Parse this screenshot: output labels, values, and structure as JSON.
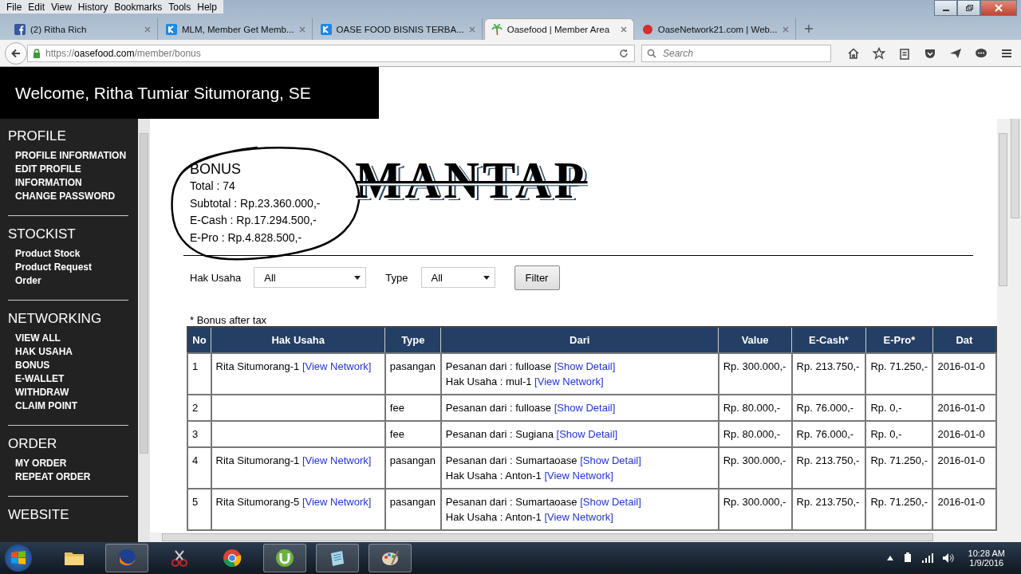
{
  "browser": {
    "menu": [
      "File",
      "Edit",
      "View",
      "History",
      "Bookmarks",
      "Tools",
      "Help"
    ],
    "tabs": [
      {
        "title": "(2) Ritha Rich",
        "selected": false
      },
      {
        "title": "MLM, Member Get Memb...",
        "selected": false
      },
      {
        "title": "OASE FOOD BISNIS TERBA...",
        "selected": false
      },
      {
        "title": "Oasefood | Member Area",
        "selected": true
      },
      {
        "title": "OaseNetwork21.com | Web...",
        "selected": false
      }
    ],
    "url_scheme": "https://",
    "url_host": "oasefood.com",
    "url_path": "/member/bonus",
    "search_placeholder": "Search"
  },
  "header": {
    "welcome": "Welcome, Ritha Tumiar Situmorang, SE"
  },
  "sidebar": [
    {
      "title": "PROFILE",
      "items": [
        "PROFILE INFORMATION",
        "EDIT PROFILE",
        "INFORMATION",
        "CHANGE PASSWORD"
      ]
    },
    {
      "title": "STOCKIST",
      "items": [
        "Product Stock",
        "Product Request",
        "Order"
      ]
    },
    {
      "title": "NETWORKING",
      "items": [
        "VIEW ALL",
        "HAK USAHA",
        "BONUS",
        "E-WALLET",
        "WITHDRAW",
        "CLAIM POINT"
      ]
    },
    {
      "title": "ORDER",
      "items": [
        "MY ORDER",
        "REPEAT ORDER"
      ]
    },
    {
      "title": "WEBSITE"
    }
  ],
  "bonus": {
    "title": "BONUS",
    "lines": [
      "Total : 74",
      "Subtotal : Rp.23.360.000,-",
      "E-Cash : Rp.17.294.500,-",
      "E-Pro : Rp.4.828.500,-"
    ]
  },
  "banner": "MANTAP",
  "filters": [
    {
      "label": "Hak Usaha",
      "value": "All"
    },
    {
      "label": "Type",
      "value": "All"
    }
  ],
  "filter_button": "Filter",
  "note": "* Bonus after tax",
  "table": {
    "columns": [
      "No",
      "Hak Usaha",
      "Type",
      "Dari",
      "Value",
      "E-Cash*",
      "E-Pro*",
      "Dat"
    ],
    "rows": [
      {
        "no": "1",
        "hak_usaha": {
          "text": "Rita Situmorang-1",
          "link": "[View Network]"
        },
        "type": "pasangan",
        "dari": [
          {
            "text": "Pesanan dari : fulloase",
            "link": "[Show Detail]"
          },
          {
            "text": "Hak Usaha : mul-1",
            "link": "[View Network]"
          }
        ],
        "value": "Rp. 300.000,-",
        "ecash": "Rp. 213.750,-",
        "epro": "Rp. 71.250,-",
        "date": "2016-01-0"
      },
      {
        "no": "2",
        "hak_usaha": null,
        "type": "fee",
        "dari": [
          {
            "text": "Pesanan dari : fulloase",
            "link": "[Show Detail]"
          }
        ],
        "value": "Rp. 80.000,-",
        "ecash": "Rp. 76.000,-",
        "epro": "Rp. 0,-",
        "date": "2016-01-0"
      },
      {
        "no": "3",
        "hak_usaha": null,
        "type": "fee",
        "dari": [
          {
            "text": "Pesanan dari : Sugiana",
            "link": "[Show Detail]"
          }
        ],
        "value": "Rp. 80.000,-",
        "ecash": "Rp. 76.000,-",
        "epro": "Rp. 0,-",
        "date": "2016-01-0"
      },
      {
        "no": "4",
        "hak_usaha": {
          "text": "Rita Situmorang-1",
          "link": "[View Network]"
        },
        "type": "pasangan",
        "dari": [
          {
            "text": "Pesanan dari : Sumartaoase",
            "link": "[Show Detail]"
          },
          {
            "text": "Hak Usaha : Anton-1",
            "link": "[View Network]"
          }
        ],
        "value": "Rp. 300.000,-",
        "ecash": "Rp. 213.750,-",
        "epro": "Rp. 71.250,-",
        "date": "2016-01-0"
      },
      {
        "no": "5",
        "hak_usaha": {
          "text": "Rita Situmorang-5",
          "link": "[View Network]"
        },
        "type": "pasangan",
        "dari": [
          {
            "text": "Pesanan dari : Sumartaoase",
            "link": "[Show Detail]"
          },
          {
            "text": "Hak Usaha : Anton-1",
            "link": "[View Network]"
          }
        ],
        "value": "Rp. 300.000,-",
        "ecash": "Rp. 213.750,-",
        "epro": "Rp. 71.250,-",
        "date": "2016-01-0"
      }
    ]
  },
  "taskbar": {
    "time": "10:28 AM",
    "date": "1/9/2016"
  }
}
